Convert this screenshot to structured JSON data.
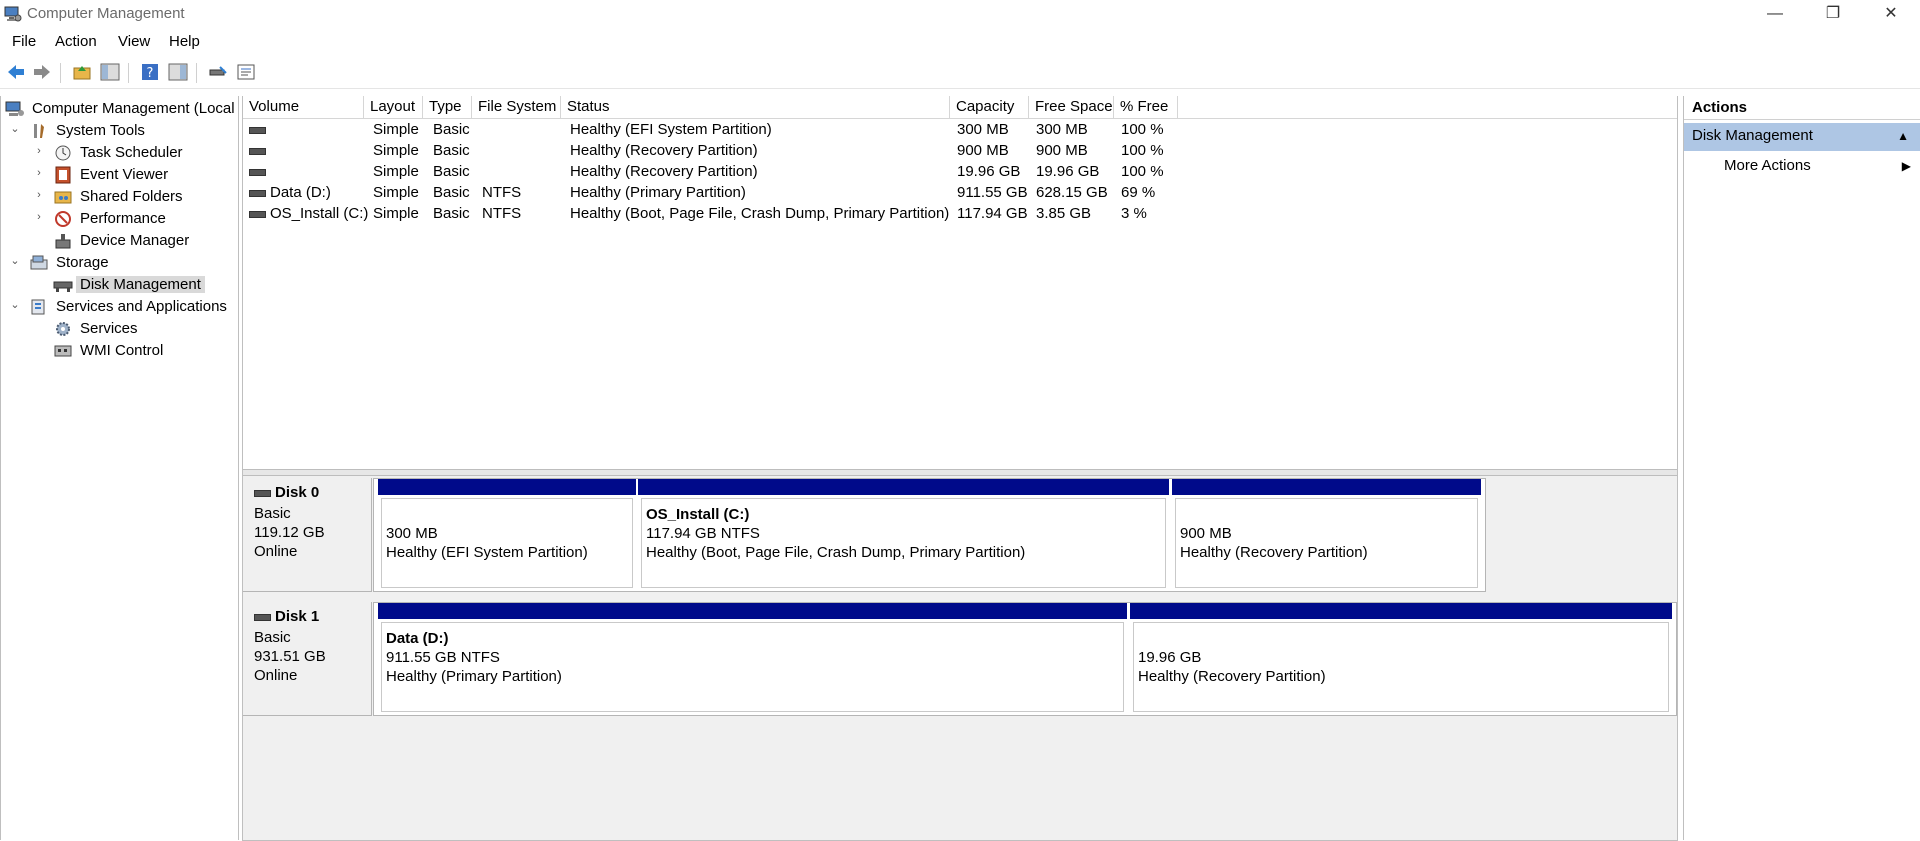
{
  "window": {
    "title": "Computer Management"
  },
  "menu": {
    "file": "File",
    "action": "Action",
    "view": "View",
    "help": "Help"
  },
  "tree": {
    "root": "Computer Management (Local",
    "system_tools": "System Tools",
    "task_scheduler": "Task Scheduler",
    "event_viewer": "Event Viewer",
    "shared_folders": "Shared Folders",
    "performance": "Performance",
    "device_manager": "Device Manager",
    "storage": "Storage",
    "disk_management": "Disk Management",
    "services_and_apps": "Services and Applications",
    "services": "Services",
    "wmi_control": "WMI Control"
  },
  "volumes": {
    "columns": [
      "Volume",
      "Layout",
      "Type",
      "File System",
      "Status",
      "Capacity",
      "Free Space",
      "% Free"
    ],
    "rows": [
      {
        "volume": "",
        "layout": "Simple",
        "type": "Basic",
        "fs": "",
        "status": "Healthy (EFI System Partition)",
        "capacity": "300 MB",
        "free": "300 MB",
        "pct": "100 %"
      },
      {
        "volume": "",
        "layout": "Simple",
        "type": "Basic",
        "fs": "",
        "status": "Healthy (Recovery Partition)",
        "capacity": "900 MB",
        "free": "900 MB",
        "pct": "100 %"
      },
      {
        "volume": "",
        "layout": "Simple",
        "type": "Basic",
        "fs": "",
        "status": "Healthy (Recovery Partition)",
        "capacity": "19.96 GB",
        "free": "19.96 GB",
        "pct": "100 %"
      },
      {
        "volume": "Data (D:)",
        "layout": "Simple",
        "type": "Basic",
        "fs": "NTFS",
        "status": "Healthy (Primary Partition)",
        "capacity": "911.55 GB",
        "free": "628.15 GB",
        "pct": "69 %"
      },
      {
        "volume": "OS_Install (C:)",
        "layout": "Simple",
        "type": "Basic",
        "fs": "NTFS",
        "status": "Healthy (Boot, Page File, Crash Dump, Primary Partition)",
        "capacity": "117.94 GB",
        "free": "3.85 GB",
        "pct": "3 %"
      }
    ]
  },
  "disks": [
    {
      "name": "Disk 0",
      "type": "Basic",
      "size": "119.12 GB",
      "state": "Online",
      "partitions": [
        {
          "name": "",
          "size": "300 MB",
          "status": "Healthy (EFI System Partition)"
        },
        {
          "name": "OS_Install  (C:)",
          "size": "117.94 GB NTFS",
          "status": "Healthy (Boot, Page File, Crash Dump, Primary Partition)"
        },
        {
          "name": "",
          "size": "900 MB",
          "status": "Healthy (Recovery Partition)"
        }
      ]
    },
    {
      "name": "Disk 1",
      "type": "Basic",
      "size": "931.51 GB",
      "state": "Online",
      "partitions": [
        {
          "name": "Data  (D:)",
          "size": "911.55 GB NTFS",
          "status": "Healthy (Primary Partition)"
        },
        {
          "name": "",
          "size": "19.96 GB",
          "status": "Healthy (Recovery Partition)"
        }
      ]
    }
  ],
  "actions": {
    "header": "Actions",
    "group": "Disk Management",
    "more": "More Actions"
  }
}
